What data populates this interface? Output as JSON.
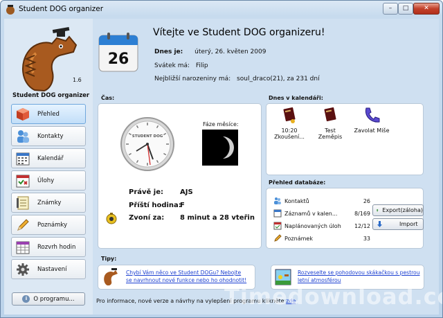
{
  "window": {
    "title": "Student DOG organizer",
    "min": "–",
    "max": "□",
    "close": "✕"
  },
  "sidebar": {
    "version": "1.6",
    "app_name": "Student DOG organizer",
    "items": [
      {
        "label": "Přehled",
        "icon": "cube-icon",
        "active": true
      },
      {
        "label": "Kontakty",
        "icon": "users-icon"
      },
      {
        "label": "Kalendář",
        "icon": "calendar-grid-icon"
      },
      {
        "label": "Úlohy",
        "icon": "tasks-icon"
      },
      {
        "label": "Známky",
        "icon": "notepad-icon"
      },
      {
        "label": "Poznámky",
        "icon": "pencil-icon"
      },
      {
        "label": "Rozvrh hodin",
        "icon": "timetable-icon"
      },
      {
        "label": "Nastavení",
        "icon": "gear-icon"
      }
    ],
    "about_label": "O programu..."
  },
  "header": {
    "day_number": "26",
    "welcome": "Vítejte ve Student DOG organizeru!",
    "today_label": "Dnes je:",
    "today_value": "úterý, 26. květen 2009",
    "nameday_label": "Svátek má:",
    "nameday_value": "Filip",
    "birthday_label": "Nejbližší narozeniny má:",
    "birthday_value": "soul_draco(21), za 231 dní"
  },
  "time_panel": {
    "label": "Čas:",
    "clock_brand": "STUDENT DOG",
    "moon_label": "Fáze měsíce:",
    "now_label": "Právě je:",
    "now_value": "AJS",
    "next_label": "Příští hodina:",
    "next_value": "F",
    "bell_label": "Zvoní za:",
    "bell_value": "8 minut a 28 vteřin"
  },
  "calendar_panel": {
    "label": "Dnes v kalendáři:",
    "items": [
      {
        "line1": "10:20",
        "line2": "Zkoušení...",
        "icon": "book-icon"
      },
      {
        "line1": "Test Zeměpis",
        "line2": "",
        "icon": "book-icon"
      },
      {
        "line1": "Zavolat Miše",
        "line2": "",
        "icon": "phone-icon"
      }
    ]
  },
  "db_panel": {
    "label": "Přehled databáze:",
    "rows": [
      {
        "label": "Kontaktů",
        "value": "26"
      },
      {
        "label": "Záznamů v kalen...",
        "value": "8/169"
      },
      {
        "label": "Naplánovaných úloh",
        "value": "12/12"
      },
      {
        "label": "Poznámek",
        "value": "33"
      }
    ],
    "export_label": "Export(záloha)",
    "import_label": "Import"
  },
  "tips": {
    "label": "Tipy:",
    "tip1_line1": "Chybí Vám něco ve Student DOGu? Nebojte",
    "tip1_line2": "se navrhnout nové funkce nebo ho ohodnotit!",
    "tip2_line1": "Rozveselte se pohodovou skákačkou s pestrou",
    "tip2_line2": "letní atmosférou"
  },
  "footer": {
    "text": "Pro informace, nové verze a návrhy na vylepšení programu klikněte",
    "link": "zde"
  },
  "watermark": "Timedownload.com",
  "colors": {
    "accent": "#6fa7dc",
    "link": "#1b3fd1",
    "calendar_blue": "#2d7fd3"
  }
}
